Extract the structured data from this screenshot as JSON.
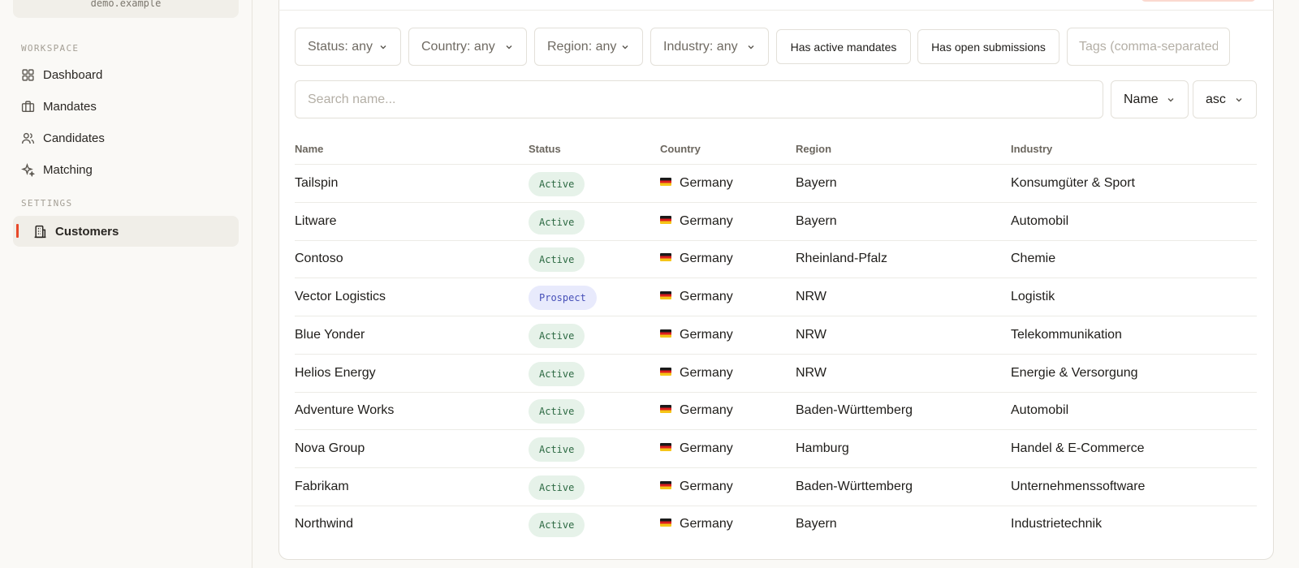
{
  "sidebar": {
    "org_domain": "demo.example",
    "workspace_label": "WORKSPACE",
    "settings_label": "SETTINGS",
    "items": [
      {
        "label": "Dashboard",
        "icon": "grid-icon"
      },
      {
        "label": "Mandates",
        "icon": "briefcase-icon"
      },
      {
        "label": "Candidates",
        "icon": "users-icon"
      },
      {
        "label": "Matching",
        "icon": "sparkle-icon"
      }
    ],
    "settings_items": [
      {
        "label": "Customers",
        "icon": "building-icon",
        "active": true
      }
    ]
  },
  "filters": {
    "status": "Status: any",
    "country": "Country: any",
    "region": "Region: any",
    "industry": "Industry: any",
    "has_active_mandates": "Has active mandates",
    "has_open_submissions": "Has open submissions",
    "tags_placeholder": "Tags (comma-separated)"
  },
  "search": {
    "placeholder": "Search name...",
    "sort_field": "Name",
    "sort_dir": "asc"
  },
  "table": {
    "headers": [
      "Name",
      "Status",
      "Country",
      "Region",
      "Industry"
    ],
    "rows": [
      {
        "name": "Tailspin",
        "status": "Active",
        "country": "Germany",
        "region": "Bayern",
        "industry": "Konsumgüter & Sport"
      },
      {
        "name": "Litware",
        "status": "Active",
        "country": "Germany",
        "region": "Bayern",
        "industry": "Automobil"
      },
      {
        "name": "Contoso",
        "status": "Active",
        "country": "Germany",
        "region": "Rheinland-Pfalz",
        "industry": "Chemie"
      },
      {
        "name": "Vector Logistics",
        "status": "Prospect",
        "country": "Germany",
        "region": "NRW",
        "industry": "Logistik"
      },
      {
        "name": "Blue Yonder",
        "status": "Active",
        "country": "Germany",
        "region": "NRW",
        "industry": "Telekommunikation"
      },
      {
        "name": "Helios Energy",
        "status": "Active",
        "country": "Germany",
        "region": "NRW",
        "industry": "Energie & Versorgung"
      },
      {
        "name": "Adventure Works",
        "status": "Active",
        "country": "Germany",
        "region": "Baden-Württemberg",
        "industry": "Automobil"
      },
      {
        "name": "Nova Group",
        "status": "Active",
        "country": "Germany",
        "region": "Hamburg",
        "industry": "Handel & E-Commerce"
      },
      {
        "name": "Fabrikam",
        "status": "Active",
        "country": "Germany",
        "region": "Baden-Württemberg",
        "industry": "Unternehmenssoftware"
      },
      {
        "name": "Northwind",
        "status": "Active",
        "country": "Germany",
        "region": "Bayern",
        "industry": "Industrietechnik"
      }
    ]
  },
  "colors": {
    "accent": "#e8492a",
    "active_badge_bg": "#e6f2e9",
    "active_badge_fg": "#2d6a43",
    "prospect_badge_bg": "#e8eafc",
    "prospect_badge_fg": "#4750b8"
  }
}
